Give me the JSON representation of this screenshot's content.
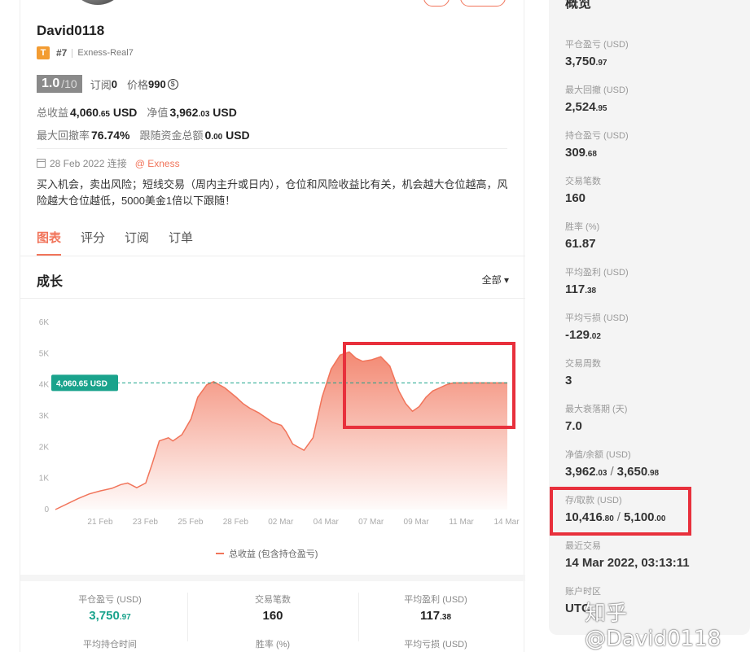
{
  "profile": {
    "name": "David0118",
    "tier_badge": "T",
    "rank": "#7",
    "account": "Exness-Real7",
    "score": "1.0",
    "score_max": "/10",
    "subs_label": "订阅",
    "subs_value": "0",
    "price_label": "价格",
    "price_value": "990",
    "price_coin": "$"
  },
  "stats": {
    "total_profit_label": "总收益",
    "total_profit_main": "4,060",
    "total_profit_dec": ".65",
    "total_profit_unit": "USD",
    "equity_label": "净值",
    "equity_main": "3,962",
    "equity_dec": ".03",
    "equity_unit": "USD",
    "drawdown_label": "最大回撤率",
    "drawdown_value": "76.74%",
    "follow_label": "跟随资金总额",
    "follow_main": "0",
    "follow_dec": ".00",
    "follow_unit": "USD"
  },
  "meta": {
    "date": "28 Feb 2022 连接",
    "broker_link": "@ Exness",
    "description": "买入机会，卖出风险；短线交易（周内主升或日内），仓位和风险收益比有关，机会越大仓位越高，风险越大仓位越低，5000美金1倍以下跟随！"
  },
  "tabs": [
    "图表",
    "评分",
    "订阅",
    "订单"
  ],
  "chart_header": {
    "title": "成长",
    "filter": "全部",
    "filter_arrow": "▾"
  },
  "colors": {
    "accent": "#f1745a",
    "positive": "#1aa38c",
    "highlight": "#e8303c",
    "marker_bg": "#1aa38c"
  },
  "chart_data": {
    "type": "area",
    "x_tick_labels": [
      "21 Feb",
      "23 Feb",
      "25 Feb",
      "28 Feb",
      "02 Mar",
      "04 Mar",
      "07 Mar",
      "09 Mar",
      "11 Mar",
      "14 Mar"
    ],
    "y_tick_labels": [
      "0",
      "1K",
      "2K",
      "3K",
      "4K",
      "5K",
      "6K"
    ],
    "ylim": [
      0,
      6000
    ],
    "series": [
      {
        "name": "总收益 (包含持仓盈亏)",
        "x": [
          0,
          1,
          1.5,
          2,
          2.5,
          2.9,
          3.2,
          3.6,
          4.0,
          4.3,
          4.6,
          5.0,
          5.2,
          5.6,
          6.0,
          6.3,
          6.7,
          7.0,
          7.5,
          8.0,
          8.3,
          8.6,
          9.0,
          9.3,
          9.6,
          10.0,
          10.2,
          10.5,
          11.0,
          11.4,
          11.8,
          12.2,
          12.6,
          13.0,
          13.3,
          13.6,
          14.0,
          14.4,
          14.8,
          15.2,
          15.5,
          15.8,
          16.1,
          16.4,
          16.7,
          17.0,
          17.3,
          17.6,
          18.0,
          18.4,
          18.8,
          19.1,
          19.4,
          19.8,
          20.0
        ],
        "y": [
          0,
          350,
          500,
          600,
          680,
          800,
          850,
          700,
          850,
          1500,
          2200,
          2300,
          2200,
          2400,
          2900,
          3600,
          4000,
          4100,
          3900,
          3600,
          3400,
          3250,
          3100,
          2950,
          2800,
          2700,
          2500,
          2100,
          1900,
          2300,
          3600,
          4500,
          4950,
          5050,
          4850,
          4750,
          4800,
          4900,
          4600,
          3800,
          3400,
          3150,
          3300,
          3600,
          3800,
          3900,
          4000,
          4060,
          4060,
          4060,
          4060,
          4060,
          4060,
          4060,
          4060
        ]
      }
    ],
    "current_marker": "4,060.65 USD",
    "current_value": 4060.65,
    "legend": "总收益 (包含持仓盈亏)",
    "grid": false
  },
  "bottom_stats": {
    "col1_label": "平仓盈亏 (USD)",
    "col1_main": "3,750",
    "col1_dec": ".97",
    "col1_label2": "平均持仓时间",
    "col2_label": "交易笔数",
    "col2_value": "160",
    "col2_label2": "胜率 (%)",
    "col3_label": "平均盈利 (USD)",
    "col3_main": "117",
    "col3_dec": ".38",
    "col3_label2": "平均亏损 (USD)"
  },
  "overview": {
    "title": "概览",
    "items": [
      {
        "label": "平仓盈亏 (USD)",
        "main": "3,750",
        "dec": ".97"
      },
      {
        "label": "最大回撤 (USD)",
        "main": "2,524",
        "dec": ".95"
      },
      {
        "label": "持仓盈亏 (USD)",
        "main": "309",
        "dec": ".68"
      },
      {
        "label": "交易笔数",
        "main": "160",
        "dec": ""
      },
      {
        "label": "胜率 (%)",
        "main": "61.87",
        "dec": ""
      },
      {
        "label": "平均盈利 (USD)",
        "main": "117",
        "dec": ".38"
      },
      {
        "label": "平均亏损 (USD)",
        "main": "-129",
        "dec": ".02"
      },
      {
        "label": "交易周数",
        "main": "3",
        "dec": ""
      },
      {
        "label": "最大衰落期 (天)",
        "main": "7.0",
        "dec": ""
      },
      {
        "label": "净值/余额 (USD)",
        "main": "3,962",
        "dec": ".03",
        "main2": "3,650",
        "dec2": ".98"
      },
      {
        "label": "存/取款 (USD)",
        "main": "10,416",
        "dec": ".80",
        "main2": "5,100",
        "dec2": ".00"
      },
      {
        "label": "最近交易",
        "main": "14 Mar 2022, 03:13:11",
        "dec": ""
      },
      {
        "label": "账户时区",
        "main": "UTC",
        "dec": ""
      }
    ],
    "slash": "/"
  },
  "watermark": "知乎 @David0118"
}
